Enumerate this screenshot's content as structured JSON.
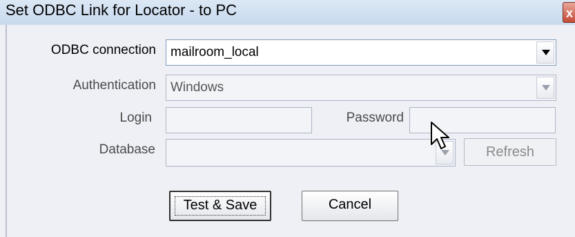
{
  "window": {
    "title": "Set ODBC Link for Locator - to PC",
    "close_symbol": "x"
  },
  "form": {
    "odbc_connection": {
      "label": "ODBC connection",
      "value": "mailroom_local"
    },
    "authentication": {
      "label": "Authentication",
      "value": "Windows"
    },
    "login": {
      "label": "Login",
      "value": ""
    },
    "password": {
      "label": "Password",
      "value": ""
    },
    "database": {
      "label": "Database",
      "value": ""
    }
  },
  "buttons": {
    "refresh": "Refresh",
    "test_save": "Test & Save",
    "cancel": "Cancel"
  },
  "icons": {
    "close": "close-icon",
    "dropdown": "chevron-down-icon",
    "cursor": "mouse-pointer-icon"
  },
  "colors": {
    "titlebar": "#c7d9ee",
    "panel": "#eef0f5",
    "close_button": "#c44a35"
  }
}
